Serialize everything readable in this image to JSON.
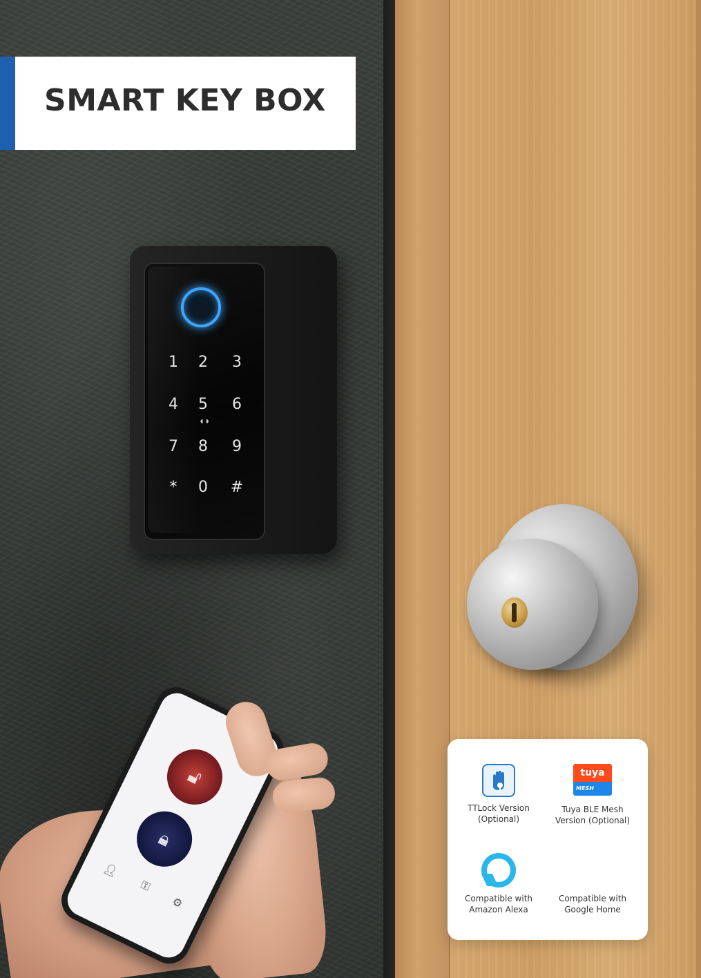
{
  "title": "SMART KEY BOX",
  "colors": {
    "accent": "#1f5fb0",
    "fingerprint_ring": "#3ea6ff",
    "alexa": "#29b6ea",
    "tuya_orange": "#ff4a1c",
    "tuya_blue": "#1d86e8"
  },
  "keypad": {
    "keys": [
      "1",
      "2",
      "3",
      "4",
      "5",
      "6",
      "7",
      "8",
      "9",
      "*",
      "0",
      "#"
    ]
  },
  "phone_app": {
    "icons": [
      "lock-open-icon",
      "lock-icon"
    ]
  },
  "features": [
    {
      "icon": "ttlock-icon",
      "label": "TTLock Version\n(Optional)"
    },
    {
      "icon": "tuya-mesh-icon",
      "label": "Tuya BLE Mesh\nVersion (Optional)",
      "logo_text": "tuya",
      "logo_subtext": "MESH Version"
    },
    {
      "icon": "alexa-icon",
      "label": "Compatible with\nAmazon Alexa"
    },
    {
      "icon": "google-home-icon",
      "label": "Compatible with\nGoogle Home"
    }
  ]
}
